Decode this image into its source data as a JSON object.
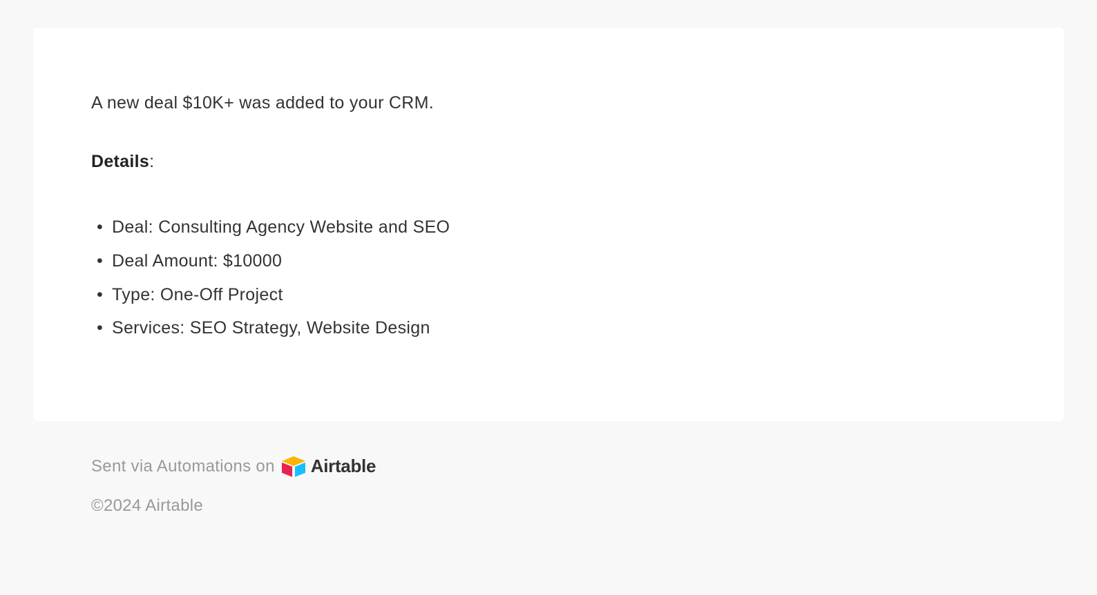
{
  "card": {
    "intro": "A new deal $10K+ was added to your CRM.",
    "details_label": "Details",
    "items": [
      "Deal: Consulting Agency Website and SEO",
      "Deal Amount: $10000",
      "Type: One-Off Project",
      "Services: SEO Strategy, Website Design"
    ]
  },
  "footer": {
    "sent_via": "Sent via Automations on",
    "brand": "Airtable",
    "copyright": "©2024 Airtable"
  }
}
